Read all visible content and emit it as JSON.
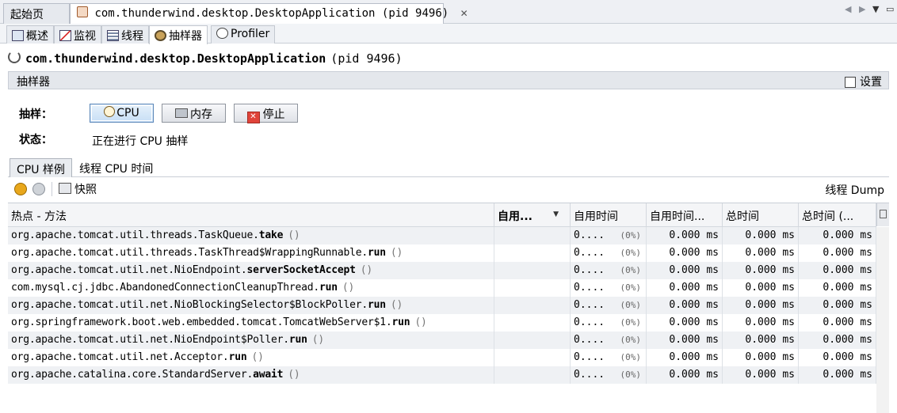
{
  "doc_tabs": {
    "start": "起始页",
    "app": "com.thunderwind.desktop.DesktopApplication (pid 9496)"
  },
  "view_tabs": [
    "概述",
    "监视",
    "线程",
    "抽样器",
    "Profiler"
  ],
  "header": {
    "app_name": "com.thunderwind.desktop.DesktopApplication",
    "pid": "(pid 9496)"
  },
  "sampler": {
    "title": "抽样器",
    "settings_label": "设置",
    "sample_label": "抽样：",
    "status_label": "状态：",
    "status_value": "正在进行 CPU 抽样",
    "buttons": {
      "cpu": "CPU",
      "memory": "内存",
      "stop": "停止"
    }
  },
  "sub_tabs": [
    "CPU 样例",
    "线程 CPU 时间"
  ],
  "toolbar": {
    "snapshot": "快照",
    "thread_dump": "线程 Dump"
  },
  "table": {
    "columns": [
      "热点 - 方法",
      "自用...",
      "自用时间",
      "自用时间...",
      "总时间",
      "总时间 (..."
    ],
    "rows": [
      {
        "pkg": "org.apache.tomcat.util.threads.TaskQueue.",
        "method": "take",
        "params": "()",
        "bar": "0....",
        "pct": "(0%)",
        "self_cpu": "0.000 ms",
        "total": "0.000 ms",
        "total_cpu": "0.000 ms"
      },
      {
        "pkg": "org.apache.tomcat.util.threads.TaskThread$WrappingRunnable.",
        "method": "run",
        "params": "()",
        "bar": "0....",
        "pct": "(0%)",
        "self_cpu": "0.000 ms",
        "total": "0.000 ms",
        "total_cpu": "0.000 ms"
      },
      {
        "pkg": "org.apache.tomcat.util.net.NioEndpoint.",
        "method": "serverSocketAccept",
        "params": "()",
        "bar": "0....",
        "pct": "(0%)",
        "self_cpu": "0.000 ms",
        "total": "0.000 ms",
        "total_cpu": "0.000 ms"
      },
      {
        "pkg": "com.mysql.cj.jdbc.AbandonedConnectionCleanupThread.",
        "method": "run",
        "params": "()",
        "bar": "0....",
        "pct": "(0%)",
        "self_cpu": "0.000 ms",
        "total": "0.000 ms",
        "total_cpu": "0.000 ms"
      },
      {
        "pkg": "org.apache.tomcat.util.net.NioBlockingSelector$BlockPoller.",
        "method": "run",
        "params": "()",
        "bar": "0....",
        "pct": "(0%)",
        "self_cpu": "0.000 ms",
        "total": "0.000 ms",
        "total_cpu": "0.000 ms"
      },
      {
        "pkg": "org.springframework.boot.web.embedded.tomcat.TomcatWebServer$1.",
        "method": "run",
        "params": "()",
        "bar": "0....",
        "pct": "(0%)",
        "self_cpu": "0.000 ms",
        "total": "0.000 ms",
        "total_cpu": "0.000 ms"
      },
      {
        "pkg": "org.apache.tomcat.util.net.NioEndpoint$Poller.",
        "method": "run",
        "params": "()",
        "bar": "0....",
        "pct": "(0%)",
        "self_cpu": "0.000 ms",
        "total": "0.000 ms",
        "total_cpu": "0.000 ms"
      },
      {
        "pkg": "org.apache.tomcat.util.net.Acceptor.",
        "method": "run",
        "params": "()",
        "bar": "0....",
        "pct": "(0%)",
        "self_cpu": "0.000 ms",
        "total": "0.000 ms",
        "total_cpu": "0.000 ms"
      },
      {
        "pkg": "org.apache.catalina.core.StandardServer.",
        "method": "await",
        "params": "()",
        "bar": "0....",
        "pct": "(0%)",
        "self_cpu": "0.000 ms",
        "total": "0.000 ms",
        "total_cpu": "0.000 ms"
      }
    ]
  },
  "colors": {
    "selected_button": "#c8dff5",
    "stop_icon": "#e0443a",
    "stripe": "#eff1f4"
  }
}
